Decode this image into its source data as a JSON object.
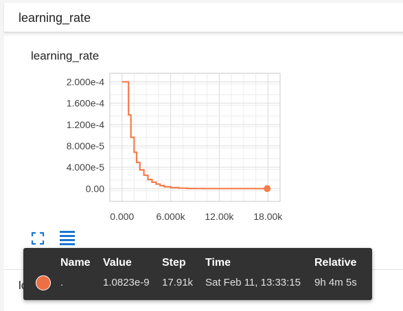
{
  "section": {
    "title": "learning_rate"
  },
  "card": {
    "title": "learning_rate"
  },
  "colors": {
    "series": "#f47c4b",
    "tooltip_bg": "#323232",
    "grid": "#dcdcdc"
  },
  "chart_data": {
    "type": "line",
    "title": "learning_rate",
    "xlim": [
      -1500,
      19500
    ],
    "ylim": [
      -2.4e-05,
      0.000216
    ],
    "x_ticks": [
      "0.000",
      "6.000k",
      "12.00k",
      "18.00k"
    ],
    "x_tick_values": [
      0,
      6000,
      12000,
      18000
    ],
    "y_ticks": [
      "2.000e-4",
      "1.600e-4",
      "1.200e-4",
      "8.000e-5",
      "4.000e-5",
      "0.00"
    ],
    "y_tick_values": [
      0.0002,
      0.00016,
      0.00012,
      8e-05,
      4e-05,
      0
    ],
    "grid": true,
    "series": [
      {
        "x": [
          0,
          500,
          800,
          1100,
          1500,
          1800,
          2200,
          2700,
          3200,
          3700,
          4200,
          4700,
          5200,
          6000,
          7000,
          8000,
          9000,
          10000,
          12000,
          14000,
          16000,
          17910
        ],
        "y": [
          0.0002,
          0.0002,
          0.000138,
          9.6e-05,
          6.8e-05,
          4.9e-05,
          3.5e-05,
          2.5e-05,
          1.7e-05,
          1.2e-05,
          8.5e-06,
          5.5e-06,
          3.5e-06,
          1.8e-06,
          8e-07,
          3e-07,
          1.2e-07,
          5e-08,
          1e-08,
          3e-09,
          1e-09,
          1.0823e-09
        ]
      }
    ]
  },
  "toolbar": {
    "expand_icon": "expand-icon",
    "data_toggle_icon": "list-icon"
  },
  "collapsed": {
    "label": "losses"
  },
  "tooltip": {
    "headers": {
      "name": "Name",
      "value": "Value",
      "step": "Step",
      "time": "Time",
      "relative": "Relative"
    },
    "row": {
      "name": ".",
      "value": "1.0823e-9",
      "step": "17.91k",
      "time": "Sat Feb 11, 13:33:15",
      "relative": "9h 4m 5s"
    }
  }
}
